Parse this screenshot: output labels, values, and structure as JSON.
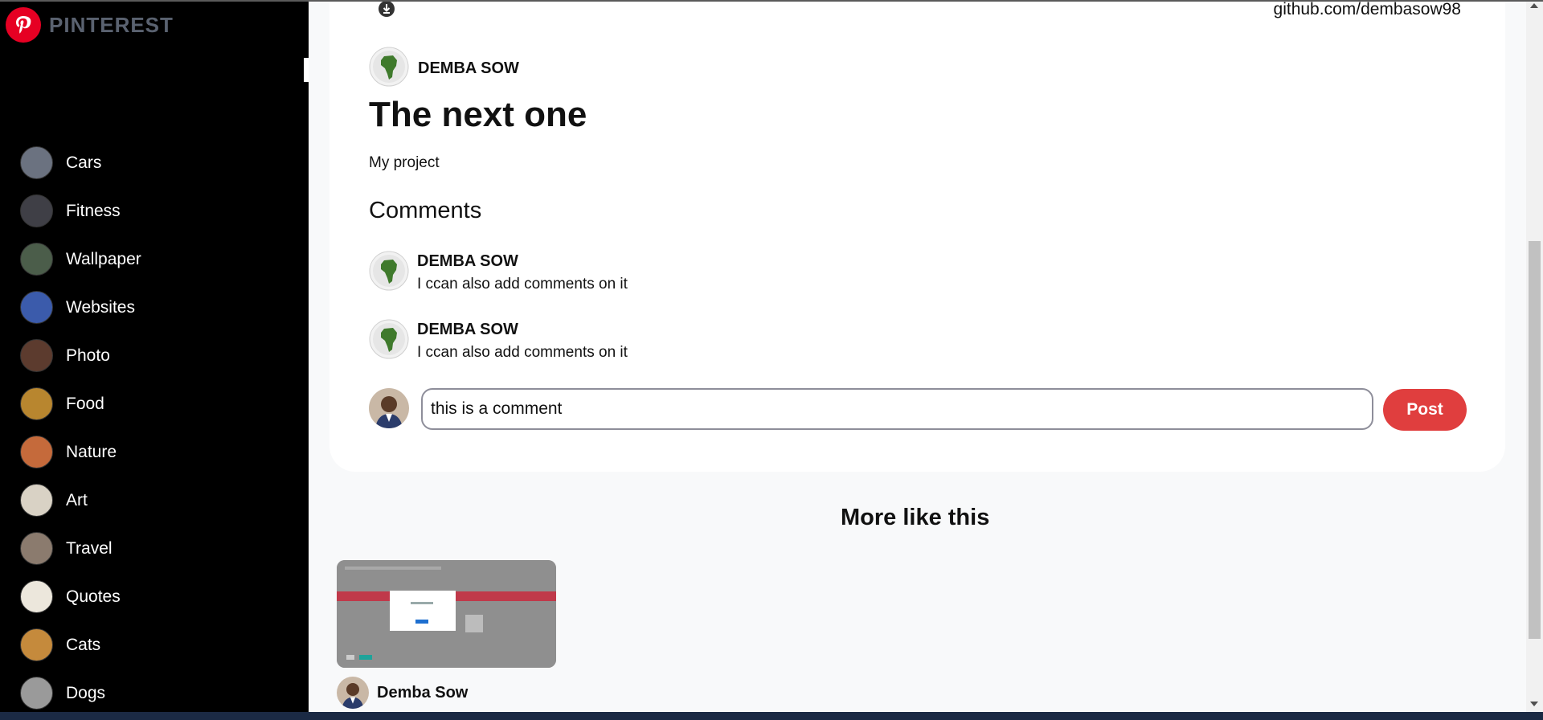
{
  "brand": {
    "name": "PINTEREST"
  },
  "categories": [
    {
      "label": "Cars",
      "color": "#6b7280"
    },
    {
      "label": "Fitness",
      "color": "#3f3f46"
    },
    {
      "label": "Wallpaper",
      "color": "#4b5d4a"
    },
    {
      "label": "Websites",
      "color": "#3b5bab"
    },
    {
      "label": "Photo",
      "color": "#5c3b2e"
    },
    {
      "label": "Food",
      "color": "#b8862f"
    },
    {
      "label": "Nature",
      "color": "#c56a3b"
    },
    {
      "label": "Art",
      "color": "#d9d2c5"
    },
    {
      "label": "Travel",
      "color": "#8b7b6e"
    },
    {
      "label": "Quotes",
      "color": "#ece7dc"
    },
    {
      "label": "Cats",
      "color": "#c58a3c"
    },
    {
      "label": "Dogs",
      "color": "#9a9a9a"
    }
  ],
  "pin": {
    "link": "github.com/dembasow98",
    "owner": "DEMBA SOW",
    "title": "The next one",
    "description": "My project"
  },
  "comments_section": {
    "heading": "Comments",
    "items": [
      {
        "author": "DEMBA SOW",
        "text": "I ccan also add comments on it"
      },
      {
        "author": "DEMBA SOW",
        "text": "I ccan also add comments on it"
      }
    ],
    "input_value": "this is a comment",
    "post_label": "Post"
  },
  "more": {
    "heading": "More like this",
    "items": [
      {
        "author": "Demba Sow"
      }
    ]
  },
  "colors": {
    "accent": "#e03e3e",
    "brand": "#e60023"
  }
}
